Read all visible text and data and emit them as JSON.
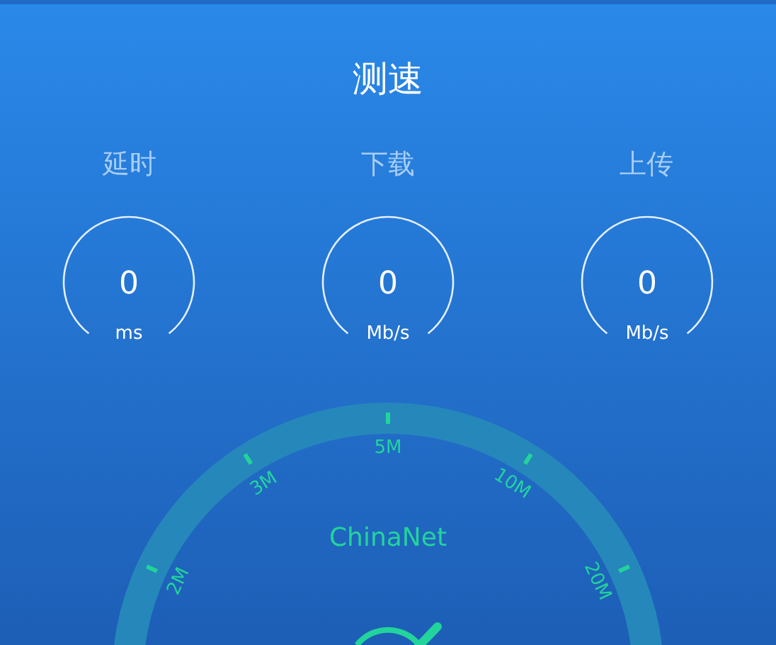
{
  "title": "测速",
  "metrics": [
    {
      "label": "延时",
      "value": "0",
      "unit": "ms"
    },
    {
      "label": "下载",
      "value": "0",
      "unit": "Mb/s"
    },
    {
      "label": "上传",
      "value": "0",
      "unit": "Mb/s"
    }
  ],
  "gauge": {
    "carrier": "ChinaNet",
    "scale_labels": [
      "2M",
      "3M",
      "5M",
      "10M",
      "20M"
    ]
  }
}
